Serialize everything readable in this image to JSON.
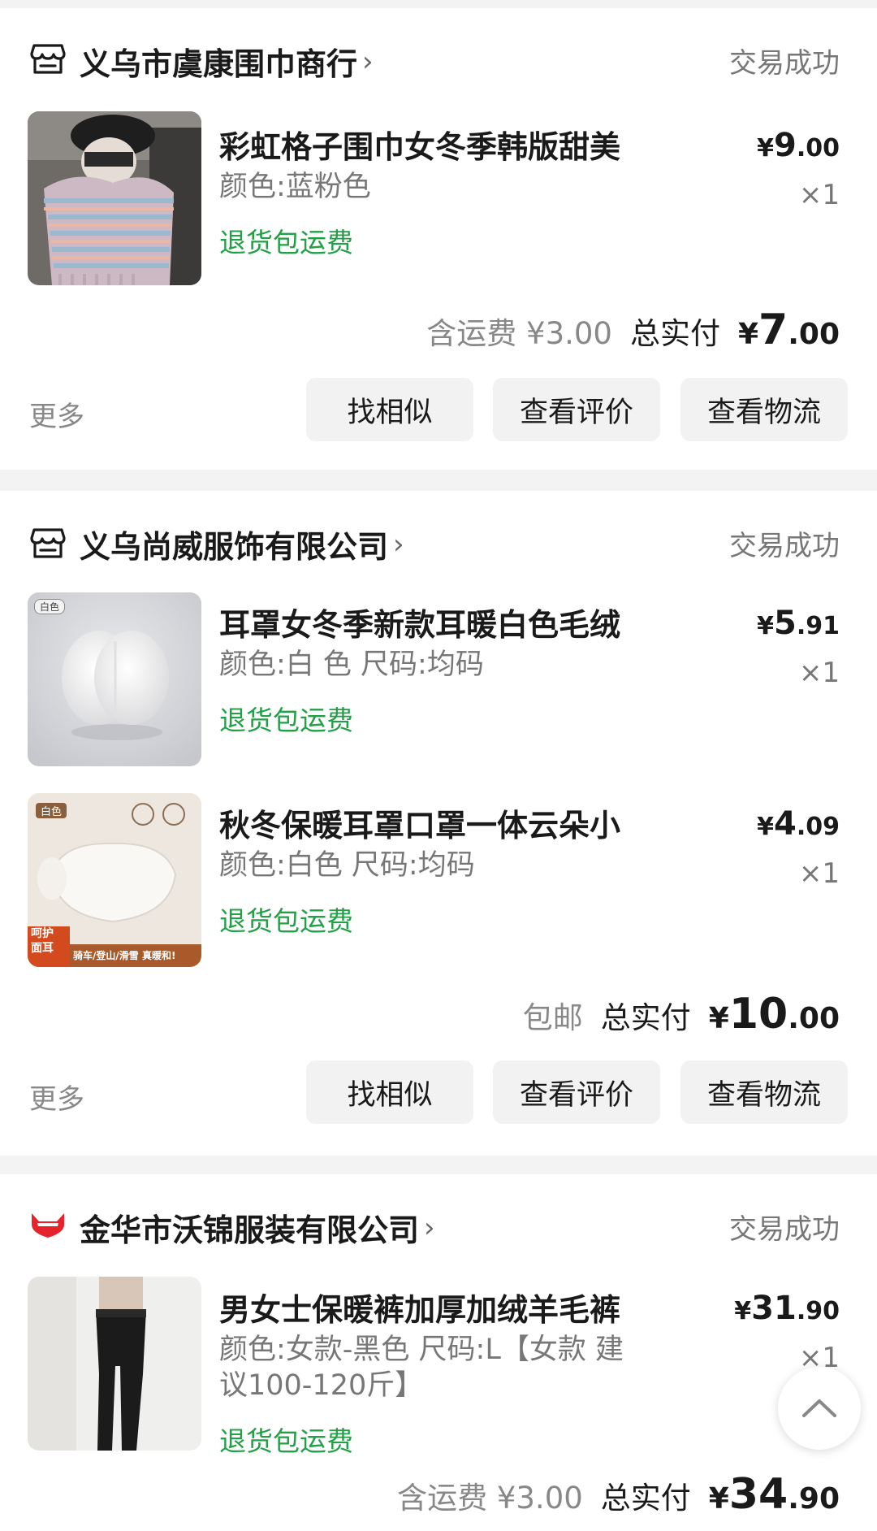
{
  "orders": [
    {
      "shop_name": "义乌市虞康围巾商行",
      "status": "交易成功",
      "items": [
        {
          "title": "彩虹格子围巾女冬季韩版甜美",
          "spec": "颜色:蓝粉色",
          "returns": "退货包运费",
          "price_symbol": "¥",
          "price_int": "9",
          "price_dec": ".00",
          "qty": "×1"
        }
      ],
      "shipping": "含运费 ¥3.00",
      "total_label": "总实付",
      "total_symbol": "¥",
      "total_int": "7",
      "total_dec": ".00",
      "more": "更多",
      "buttons": [
        "找相似",
        "查看评价",
        "查看物流"
      ]
    },
    {
      "shop_name": "义乌尚威服饰有限公司",
      "status": "交易成功",
      "items": [
        {
          "title": "耳罩女冬季新款耳暖白色毛绒",
          "spec": "颜色:白 色 尺码:均码",
          "returns": "退货包运费",
          "price_symbol": "¥",
          "price_int": "5",
          "price_dec": ".91",
          "qty": "×1",
          "image_tag": "白色"
        },
        {
          "title": "秋冬保暖耳罩口罩一体云朵小",
          "spec": "颜色:白色 尺码:均码",
          "returns": "退货包运费",
          "price_symbol": "¥",
          "price_int": "4",
          "price_dec": ".09",
          "qty": "×1",
          "image_tag": "白色",
          "image_badge": "呵护\n面耳",
          "image_caption": "骑车/登山/滑雪 真暖和!"
        }
      ],
      "shipping": "包邮",
      "total_label": "总实付",
      "total_symbol": "¥",
      "total_int": "10",
      "total_dec": ".00",
      "more": "更多",
      "buttons": [
        "找相似",
        "查看评价",
        "查看物流"
      ]
    },
    {
      "shop_name": "金华市沃锦服装有限公司",
      "status": "交易成功",
      "items": [
        {
          "title": "男女士保暖裤加厚加绒羊毛裤",
          "spec_line1": "颜色:女款-黑色 尺码:L【女款 建",
          "spec_line2": "议100-120斤】",
          "returns": "退货包运费",
          "price_symbol": "¥",
          "price_int": "31",
          "price_dec": ".90",
          "qty": "×1"
        }
      ],
      "shipping": "含运费 ¥3.00",
      "total_label": "总实付",
      "total_symbol": "¥",
      "total_int": "34",
      "total_dec": ".90"
    }
  ],
  "icons": {
    "store": "store-icon",
    "tmall": "tmall-cat-icon",
    "chevron": "chevron-right-icon",
    "scroll_top": "chevron-up-icon"
  },
  "colors": {
    "green": "#22a046",
    "tmall_red": "#e6232b",
    "background": "#f3f3f3"
  }
}
